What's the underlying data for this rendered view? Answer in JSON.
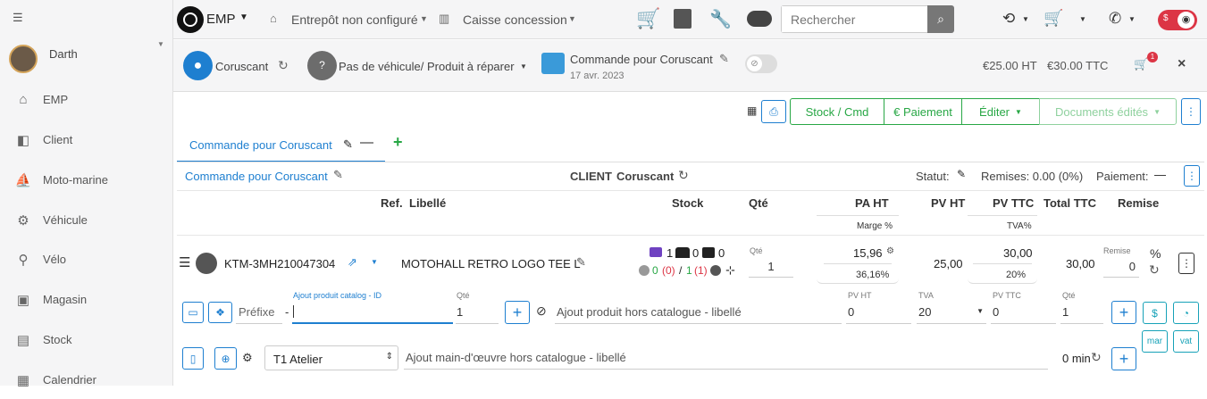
{
  "sidebar": {
    "user_name": "Darth",
    "items": [
      {
        "label": "EMP",
        "icon": "home-icon"
      },
      {
        "label": "Client",
        "icon": "client-icon"
      },
      {
        "label": "Moto-marine",
        "icon": "jetski-icon"
      },
      {
        "label": "Véhicule",
        "icon": "motorcycle-icon"
      },
      {
        "label": "Vélo",
        "icon": "bicycle-icon"
      },
      {
        "label": "Magasin",
        "icon": "store-icon"
      },
      {
        "label": "Stock",
        "icon": "warehouse-icon"
      },
      {
        "label": "Calendrier",
        "icon": "calendar-icon"
      }
    ]
  },
  "topbar": {
    "brand": "EMP",
    "warehouse": "Entrepôt non configuré",
    "register": "Caisse concession",
    "search_placeholder": "Rechercher",
    "toggle_label": "$"
  },
  "infobar": {
    "client": "Coruscant",
    "vehicle": "Pas de véhicule/ Produit à réparer",
    "order_title": "Commande pour Coruscant",
    "order_date": "17 avr. 2023",
    "total_ht": "€25.00 HT",
    "total_ttc": "€30.00 TTC",
    "cart_badge": "1",
    "close": "×"
  },
  "toolbar": {
    "stock_cmd": "Stock / Cmd",
    "payment": "€ Paiement",
    "edit": "Éditer",
    "documents": "Documents édités"
  },
  "tab": {
    "label": "Commande pour Coruscant",
    "add": "+"
  },
  "order": {
    "title_link": "Commande pour Coruscant",
    "client_label": "CLIENT",
    "client_name": "Coruscant",
    "statut": "Statut:",
    "remises": "Remises: 0.00 (0%)",
    "paiement": "Paiement:"
  },
  "table": {
    "headers": {
      "ref": "Ref.",
      "libelle": "Libellé",
      "stock": "Stock",
      "qte": "Qté",
      "pa_ht": "PA HT",
      "marge": "Marge %",
      "pv_ht": "PV HT",
      "pv_ttc": "PV TTC",
      "tva": "TVA%",
      "total_ttc": "Total TTC",
      "remise": "Remise"
    },
    "row": {
      "ref": "KTM-3MH210047304",
      "libelle": "MOTOHALL RETRO LOGO TEE L",
      "stock_truck": "1",
      "stock_garage": "0",
      "stock_check": "0",
      "stock_a": "0",
      "stock_b": "(0)",
      "stock_c": "1",
      "stock_d": "(1)",
      "qte_label": "Qté",
      "qte": "1",
      "pa_ht": "15,96",
      "marge": "36,16%",
      "pv_ht": "25,00",
      "pv_ttc": "30,00",
      "tva": "20%",
      "total_ttc": "30,00",
      "remise_label": "Remise",
      "remise": "0",
      "percent": "%"
    }
  },
  "add_product": {
    "prefix_placeholder": "Préfixe",
    "dash": "-",
    "catalog_label": "Ajout produit catalog - ID",
    "qty_label": "Qté",
    "qty": "1",
    "hors_catalogue_placeholder": "Ajout produit hors catalogue - libellé",
    "pv_ht_label": "PV HT",
    "pv_ht": "0",
    "tva_label": "TVA",
    "tva": "20",
    "pv_ttc_label": "PV TTC",
    "pv_ttc": "0",
    "qte_label": "Qté",
    "qte": "1",
    "mar": "mar",
    "vat": "vat"
  },
  "labor": {
    "atelier": "T1 Atelier",
    "placeholder": "Ajout main-d'œuvre hors catalogue - libellé",
    "minutes": "0 min"
  },
  "colors": {
    "primary": "#1e7fd0",
    "success": "#28a745",
    "danger": "#dc3545",
    "info": "#17a2b8"
  }
}
